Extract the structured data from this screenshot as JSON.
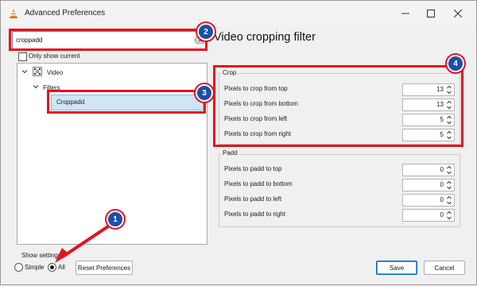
{
  "window": {
    "title": "Advanced Preferences",
    "minimize_icon": "minimize-icon",
    "maximize_icon": "maximize-icon",
    "close_icon": "close-icon"
  },
  "search": {
    "value": "croppadd",
    "placeholder": ""
  },
  "only_show_current": {
    "label": "Only show current",
    "checked": false
  },
  "tree": {
    "items": [
      {
        "label": "Video",
        "level": 0,
        "expanded": true,
        "icon": "video-icon"
      },
      {
        "label": "Filters",
        "level": 1,
        "expanded": true
      },
      {
        "label": "Croppadd",
        "level": 2,
        "selected": true
      }
    ]
  },
  "panel": {
    "title": "Video cropping filter",
    "crop": {
      "label": "Crop",
      "rows": [
        {
          "label": "Pixels to crop from top",
          "value": "13"
        },
        {
          "label": "Pixels to crop from bottom",
          "value": "13"
        },
        {
          "label": "Pixels to crop from left",
          "value": "5"
        },
        {
          "label": "Pixels to crop from right",
          "value": "5"
        }
      ]
    },
    "padd": {
      "label": "Padd",
      "rows": [
        {
          "label": "Pixels to padd to top",
          "value": "0"
        },
        {
          "label": "Pixels to padd to bottom",
          "value": "0"
        },
        {
          "label": "Pixels to padd to left",
          "value": "0"
        },
        {
          "label": "Pixels to padd to right",
          "value": "0"
        }
      ]
    }
  },
  "show_settings": {
    "label": "Show settings",
    "simple_label": "Simple",
    "all_label": "All",
    "selected": "All"
  },
  "buttons": {
    "reset": "Reset Preferences",
    "save": "Save",
    "cancel": "Cancel"
  },
  "annotations": {
    "badge_1": "1",
    "badge_2": "2",
    "badge_3": "3",
    "badge_4": "4",
    "highlight_color": "#e3121f",
    "badge_color": "#1e4fa7"
  }
}
